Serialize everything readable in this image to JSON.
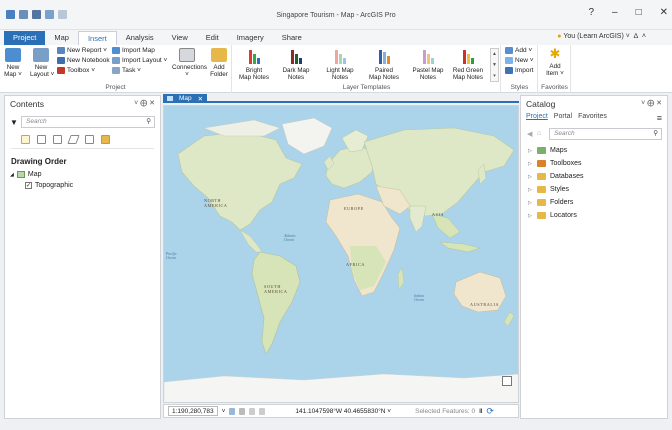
{
  "window": {
    "title": "Singapore Tourism - Map - ArcGIS Pro",
    "help": "?",
    "minimize": "–",
    "maximize": "□",
    "close": "✕"
  },
  "tabs": [
    "Project",
    "Map",
    "Insert",
    "Analysis",
    "View",
    "Edit",
    "Imagery",
    "Share"
  ],
  "active_tab": "Insert",
  "user": {
    "name": "You (Learn ArcGIS) ˅",
    "bell": "∆",
    "collapse": "˄"
  },
  "ribbon": {
    "project_group": {
      "label": "Project",
      "new_map": "New\nMap ˅",
      "new_layout": "New\nLayout ˅",
      "new_report": "New Report ˅",
      "new_notebook": "New Notebook",
      "toolbox": "Toolbox ˅",
      "import_map": "Import Map",
      "import_layout": "Import Layout ˅",
      "task": "Task ˅",
      "connections": "Connections\n˅",
      "add_folder": "Add\nFolder"
    },
    "layer_templates": {
      "label": "Layer Templates",
      "items": [
        {
          "label": "Bright\nMap Notes"
        },
        {
          "label": "Dark Map\nNotes"
        },
        {
          "label": "Light Map\nNotes"
        },
        {
          "label": "Paired\nMap Notes"
        },
        {
          "label": "Pastel Map\nNotes"
        },
        {
          "label": "Red Green\nMap Notes"
        }
      ]
    },
    "styles_group": {
      "label": "Styles",
      "add": "Add ˅",
      "new": "New ˅",
      "import": "Import"
    },
    "favorites_group": {
      "label": "Favorites",
      "add_item": "Add\nItem ˅"
    }
  },
  "contents": {
    "title": "Contents",
    "controls": "˅ ⨁ ✕",
    "search_placeholder": "Search",
    "drawing_order": "Drawing Order",
    "map_layer": "Map",
    "topographic_layer": "Topographic"
  },
  "map_tab": {
    "label": "Map",
    "close": "✕"
  },
  "map_labels": {
    "north_america": "NORTH\nAMERICA",
    "south_america": "SOUTH\nAMERICA",
    "europe": "EUROPE",
    "asia": "ASIA",
    "africa": "AFRICA",
    "australia": "AUSTRALIA",
    "atlantic": "Atlantic\nOcean",
    "indian": "Indian\nOcean",
    "pacific": "Pacific\nOcean"
  },
  "statusbar": {
    "scale": "1:190,280,783",
    "coords": "141.1047598°W 40.4655830°N ˅",
    "selected": "Selected Features: 0",
    "pause": "‖",
    "refresh": "⟳"
  },
  "catalog": {
    "title": "Catalog",
    "controls": "˅ ⨁ ✕",
    "tabs": [
      "Project",
      "Portal",
      "Favorites"
    ],
    "active_tab": "Project",
    "menu": "≡",
    "search_placeholder": "Search",
    "items": [
      "Maps",
      "Toolboxes",
      "Databases",
      "Styles",
      "Folders",
      "Locators"
    ]
  },
  "colors": {
    "accent": "#2b6fb6",
    "ocean": "#abd3ea",
    "land": "#dfe8c6",
    "desert": "#efe6cd"
  }
}
